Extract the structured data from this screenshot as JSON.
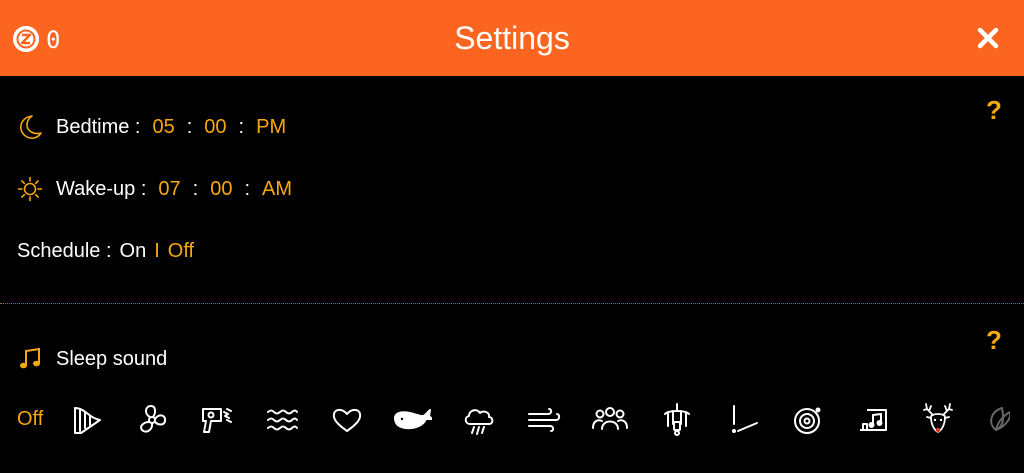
{
  "header": {
    "title": "Settings",
    "counter": "0",
    "brand_color": "#fb6520"
  },
  "bedtime": {
    "label": "Bedtime :",
    "hour": "05",
    "minute": "00",
    "ampm": "PM",
    "icon": "moon-icon"
  },
  "wakeup": {
    "label": "Wake-up :",
    "hour": "07",
    "minute": "00",
    "ampm": "AM",
    "icon": "sun-icon"
  },
  "schedule": {
    "label": "Schedule :",
    "on": "On",
    "divider": "I",
    "off": "Off",
    "selected": "Off"
  },
  "sleep_sound": {
    "label": "Sleep sound",
    "icon": "music-note-icon",
    "off_label": "Off",
    "selected": "Off",
    "options": [
      "harp-icon",
      "fan-icon",
      "hair-dryer-icon",
      "waves-icon",
      "heart-icon",
      "whale-icon",
      "rain-cloud-icon",
      "wind-icon",
      "crowd-icon",
      "mobile-toy-icon",
      "metronome-icon",
      "vinyl-icon",
      "music-box-icon",
      "reindeer-icon",
      "leaf-icon"
    ]
  },
  "help": "?",
  "colors": {
    "accent": "#f7a80c",
    "background": "#000000",
    "text": "#ffffff"
  }
}
